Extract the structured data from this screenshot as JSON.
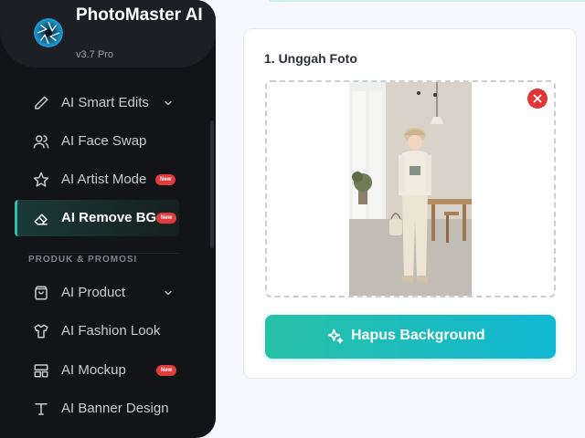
{
  "brand": {
    "name": "PhotoMaster AI",
    "version": "v3.7 Pro"
  },
  "sidebar": {
    "items": [
      {
        "label": "AI Smart Edits",
        "icon": "pencil-icon",
        "has_chevron": true
      },
      {
        "label": "AI Face Swap",
        "icon": "users-icon"
      },
      {
        "label": "AI Artist Mode",
        "icon": "star-icon",
        "badge": "New"
      },
      {
        "label": "AI Remove BG",
        "icon": "eraser-icon",
        "badge": "New",
        "active": true
      }
    ],
    "section_title": "PRODUK & PROMOSI",
    "section_items": [
      {
        "label": "AI Product",
        "icon": "shopping-bag-icon",
        "has_chevron": true
      },
      {
        "label": "AI Fashion Look",
        "icon": "shirt-icon"
      },
      {
        "label": "AI Mockup",
        "icon": "layout-icon",
        "badge": "New"
      },
      {
        "label": "AI Banner Design",
        "icon": "text-icon"
      }
    ]
  },
  "upload": {
    "title": "1. Unggah Foto"
  },
  "action": {
    "label": "Hapus Background",
    "icon": "sparkles-icon"
  },
  "colors": {
    "accent": "#2bc0a7",
    "button_start": "#27c1a6",
    "button_end": "#12b7d3",
    "badge": "#e23b3b",
    "sidebar_bg": "#121417"
  }
}
